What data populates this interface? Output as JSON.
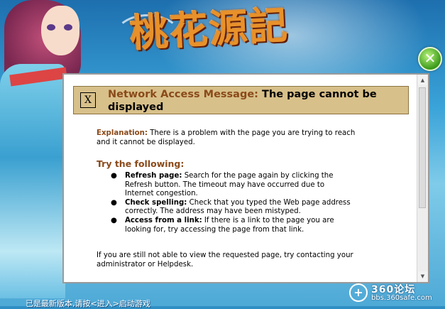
{
  "game": {
    "logo_text": "桃花源記",
    "close_icon": "close-x"
  },
  "error_page": {
    "header_label": "Network Access Message:",
    "header_title": "The page cannot be displayed",
    "icon_glyph": "X",
    "explanation_label": "Explanation:",
    "explanation_text": "There is a problem with the page you are trying to reach and it cannot be displayed.",
    "try_heading": "Try the following:",
    "items": [
      {
        "label": "Refresh page:",
        "text": "Search for the page again by clicking the Refresh button. The timeout may have occurred due to Internet congestion."
      },
      {
        "label": "Check spelling:",
        "text": "Check that you typed the Web page address correctly. The address may have been mistyped."
      },
      {
        "label": "Access from a link:",
        "text": "If there is a link to the page you are looking for, try accessing the page from that link."
      }
    ],
    "footer_text": "If you are still not able to view the requested page, try contacting your administrator or Helpdesk."
  },
  "status_bar": {
    "text": "已是最新版本,请按<进入>启动游戏"
  },
  "watermark": {
    "brand": "360论坛",
    "url": "bbs.360safe.com",
    "glyph": "+"
  },
  "colors": {
    "accent_brown": "#8a4a1a",
    "header_bg": "#d8c08a",
    "close_green": "#3a9a1a"
  }
}
